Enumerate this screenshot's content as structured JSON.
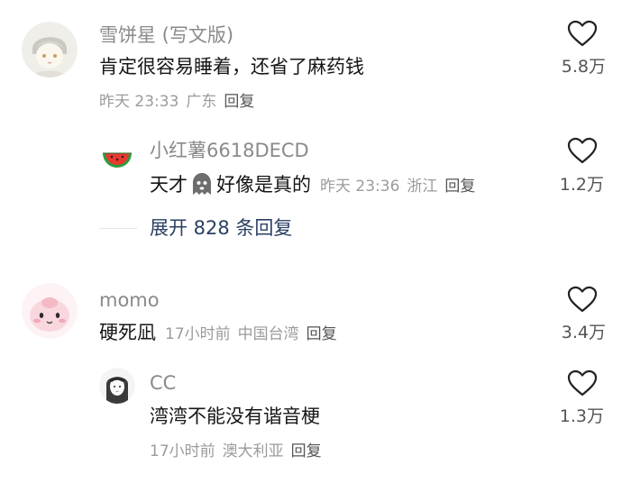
{
  "comments": [
    {
      "author": "雪饼星 (写文版)",
      "text": "肯定很容易睡着，还省了麻药钱",
      "time": "昨天 23:33",
      "location": "广东",
      "reply_label": "回复",
      "likes": "5.8万",
      "avatar_icon": "cartoon-boy-avatar",
      "replies": [
        {
          "author": "小红薯6618DECD",
          "text_before_emoji": "天才",
          "emoji_icon": "ghost-emoji",
          "text_after_emoji": "好像是真的",
          "time": "昨天 23:36",
          "location": "浙江",
          "reply_label": "回复",
          "likes": "1.2万",
          "avatar_icon": "watermelon-avatar"
        }
      ],
      "expand_label": "展开 828 条回复"
    },
    {
      "author": "momo",
      "text": "硬死凪",
      "time": "17小时前",
      "location": "中国台湾",
      "reply_label": "回复",
      "likes": "3.4万",
      "avatar_icon": "pink-blob-avatar",
      "replies": [
        {
          "author": "CC",
          "text": "湾湾不能没有谐音梗",
          "time": "17小时前",
          "location": "澳大利亚",
          "reply_label": "回复",
          "likes": "1.3万",
          "avatar_icon": "sketch-girl-avatar"
        }
      ]
    }
  ],
  "icons": {
    "like": "heart-outline-icon"
  },
  "colors": {
    "expand_link": "#2a3f62",
    "secondary_text": "#8a8a8a"
  }
}
